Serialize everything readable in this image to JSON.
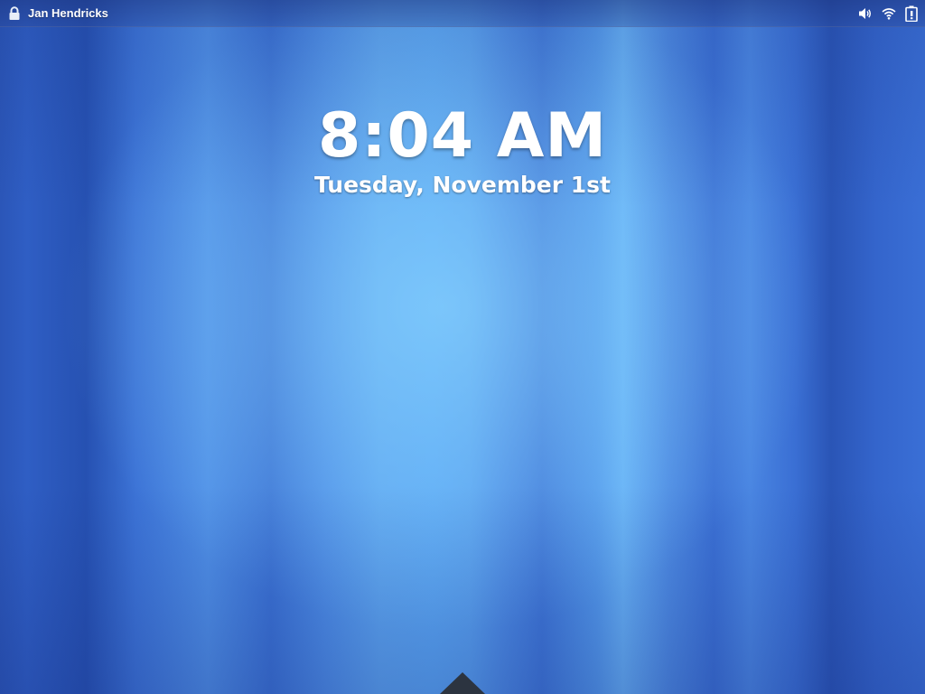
{
  "top_panel": {
    "user_name": "Jan Hendricks",
    "status_icons": [
      "volume-icon",
      "wifi-icon",
      "battery-icon"
    ]
  },
  "clock": {
    "time": "8:04 AM",
    "date": "Tuesday, November 1st"
  },
  "colors": {
    "panel_text": "#ffffff",
    "wallpaper_accent": "#4a8ae4"
  }
}
